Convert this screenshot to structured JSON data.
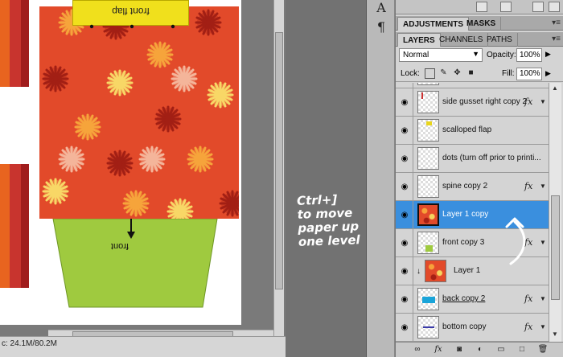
{
  "document": {
    "top_tab_label": "front flap",
    "bottom_flap_label": "front",
    "status": "c: 24.1M/80.2M"
  },
  "annotation": {
    "lines": [
      "Ctrl+]",
      "to move",
      "paper up",
      "one level"
    ]
  },
  "panel": {
    "top_tabs": [
      "ADJUSTMENTS",
      "MASKS"
    ],
    "tabs": [
      "LAYERS",
      "CHANNELS",
      "PATHS"
    ],
    "blend_mode": "Normal",
    "opacity_label": "Opacity:",
    "opacity_value": "100%",
    "lock_label": "Lock:",
    "fill_label": "Fill:",
    "fill_value": "100%"
  },
  "layers": [
    {
      "name": "side gusset right  copy 2",
      "fx": true,
      "underline": false,
      "selected": false
    },
    {
      "name": "scalloped flap",
      "fx": false,
      "underline": false,
      "selected": false
    },
    {
      "name": "dots (turn off prior to printi...",
      "fx": false,
      "underline": false,
      "selected": false
    },
    {
      "name": "spine copy 2",
      "fx": true,
      "underline": false,
      "selected": false
    },
    {
      "name": "Layer 1 copy",
      "fx": false,
      "underline": false,
      "selected": true
    },
    {
      "name": "front copy 3",
      "fx": true,
      "underline": false,
      "selected": false
    },
    {
      "name": "Layer 1",
      "fx": false,
      "underline": false,
      "selected": false
    },
    {
      "name": "back copy 2",
      "fx": true,
      "underline": true,
      "selected": false
    },
    {
      "name": "bottom  copy",
      "fx": true,
      "underline": false,
      "selected": false
    }
  ],
  "colors": {
    "selected_row": "#3a8fde",
    "paper_red": "#e24a2a",
    "flap_green": "#9fca3f",
    "tab_yellow": "#f0e01c"
  }
}
